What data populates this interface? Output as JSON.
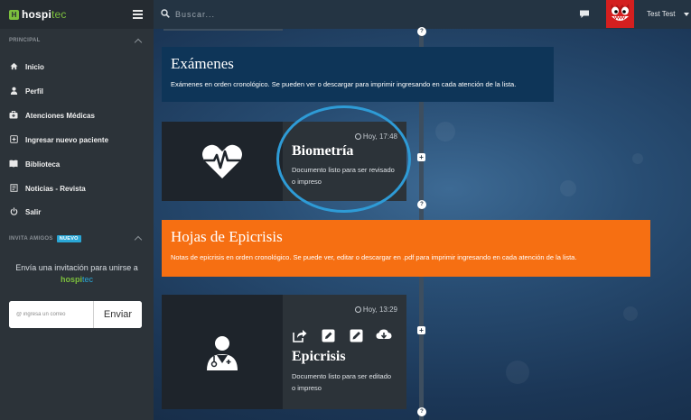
{
  "app": {
    "logo_main": "hospi",
    "logo_accent": "tec"
  },
  "search": {
    "placeholder": "Buscar..."
  },
  "user": {
    "name": "Test Test"
  },
  "sidebar": {
    "section_principal": "PRINCIPAL",
    "items": [
      {
        "label": "Inicio",
        "icon": "home-icon"
      },
      {
        "label": "Perfil",
        "icon": "user-icon"
      },
      {
        "label": "Atenciones Médicas",
        "icon": "medkit-icon"
      },
      {
        "label": "Ingresar nuevo paciente",
        "icon": "plus-square-icon"
      },
      {
        "label": "Biblioteca",
        "icon": "book-icon"
      },
      {
        "label": "Noticias - Revista",
        "icon": "newspaper-icon"
      },
      {
        "label": "Salir",
        "icon": "power-icon"
      }
    ],
    "section_invite": "INVITA AMIGOS",
    "invite_badge": "NUEVO",
    "invite_text": "Envía una invitación para unirse a",
    "invite_logo_main": "hospi",
    "invite_logo_accent": "tec",
    "invite_placeholder": "@ ingresa un correo",
    "invite_button": "Enviar"
  },
  "timeline": {
    "exams": {
      "title": "Exámenes",
      "description": "Exámenes en orden cronológico. Se pueden ver o descargar para imprimir ingresando en cada atención de la lista."
    },
    "biometria": {
      "time": "Hoy, 17:48",
      "title": "Biometría",
      "description": "Documento listo para ser revisado o impreso",
      "icon": "heartbeat-icon"
    },
    "epicrisis_section": {
      "title": "Hojas de Epicrisis",
      "description": "Notas de epicrisis en orden cronológico. Se puede ver, editar o descargar en .pdf para imprimir ingresando en cada atención de la lista."
    },
    "epicrisis": {
      "time": "Hoy, 13:29",
      "title": "Epicrisis",
      "description": "Documento listo para ser editado o impreso",
      "icon": "doctor-icon",
      "actions": [
        "share-icon",
        "edit-icon",
        "pencil-icon",
        "download-icon"
      ]
    }
  },
  "colors": {
    "brand_green": "#7cbf3d",
    "accent_blue": "#2aa7d6",
    "exams_bg": "#0e3558",
    "epicrisis_bg": "#f66f12",
    "highlight": "#2e9bd6"
  }
}
